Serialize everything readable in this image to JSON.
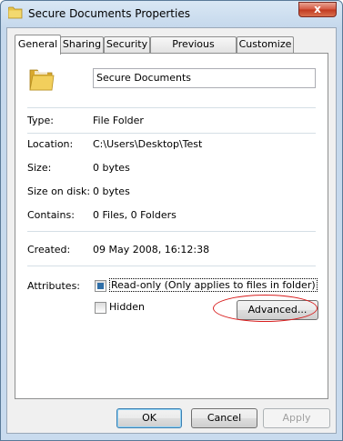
{
  "window": {
    "title": "Secure Documents Properties",
    "close_glyph": "x"
  },
  "tabs": [
    {
      "label": "General",
      "active": true
    },
    {
      "label": "Sharing",
      "active": false
    },
    {
      "label": "Security",
      "active": false
    },
    {
      "label": "Previous Versions",
      "active": false
    },
    {
      "label": "Customize",
      "active": false
    }
  ],
  "general": {
    "folder_name": "Secure Documents",
    "type": {
      "label": "Type:",
      "value": "File Folder"
    },
    "location": {
      "label": "Location:",
      "value": "C:\\Users\\Desktop\\Test"
    },
    "size": {
      "label": "Size:",
      "value": "0 bytes"
    },
    "size_on_disk": {
      "label": "Size on disk:",
      "value": "0 bytes"
    },
    "contains": {
      "label": "Contains:",
      "value": "0 Files, 0 Folders"
    },
    "created": {
      "label": "Created:",
      "value": "09 May 2008, 16:12:38"
    },
    "attributes": {
      "label": "Attributes:",
      "read_only": {
        "label": "Read-only (Only applies to files in folder)",
        "state": "partial"
      },
      "hidden": {
        "label": "Hidden",
        "state": "unchecked"
      },
      "advanced_label": "Advanced..."
    }
  },
  "footer": {
    "ok_label": "OK",
    "cancel_label": "Cancel",
    "apply_label": "Apply"
  },
  "colors": {
    "highlight_ring": "#d81e1e",
    "checkbox_fill": "#2f6ea7",
    "folder": "#e8c44a"
  },
  "icons": [
    "folder-icon",
    "close-icon"
  ]
}
